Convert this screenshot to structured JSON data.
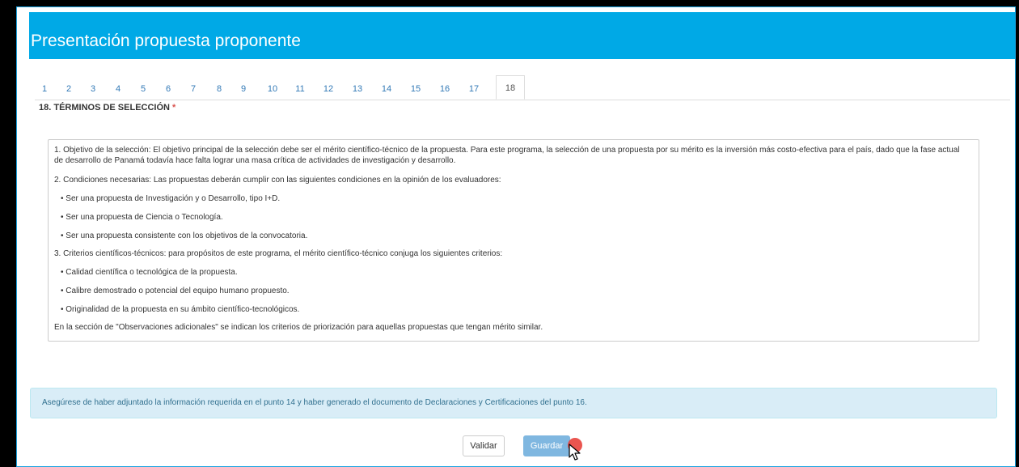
{
  "page": {
    "title": "Presentación propuesta proponente"
  },
  "tabs": [
    {
      "label": "1"
    },
    {
      "label": "2"
    },
    {
      "label": "3"
    },
    {
      "label": "4"
    },
    {
      "label": "5"
    },
    {
      "label": "6"
    },
    {
      "label": "7"
    },
    {
      "label": "8"
    },
    {
      "label": "9"
    },
    {
      "label": "10"
    },
    {
      "label": "11"
    },
    {
      "label": "12"
    },
    {
      "label": "13"
    },
    {
      "label": "14"
    },
    {
      "label": "15"
    },
    {
      "label": "16"
    },
    {
      "label": "17"
    },
    {
      "label": "18",
      "active": true
    }
  ],
  "section": {
    "title": "18. TÉRMINOS DE SELECCIÓN",
    "required_mark": "*"
  },
  "terms": {
    "paragraphs": [
      "1. Objetivo de la selección: El objetivo principal de la selección debe ser el mérito científico-técnico de la propuesta. Para este programa, la selección de una propuesta por su mérito es la inversión más costo-efectiva para el país, dado que la fase actual de desarrollo de Panamá todavía hace falta lograr una masa crítica de actividades de investigación y desarrollo.",
      "2. Condiciones necesarias: Las propuestas deberán cumplir con las siguientes condiciones en la opinión de los evaluadores:",
      "• Ser una propuesta de Investigación y o Desarrollo, tipo I+D.",
      "• Ser una propuesta de Ciencia o Tecnología.",
      "• Ser una propuesta consistente con los objetivos de la convocatoria.",
      "3. Criterios científicos-técnicos: para propósitos de este programa, el mérito científico-técnico conjuga los siguientes criterios:",
      "• Calidad científica o tecnológica de la propuesta.",
      "• Calibre demostrado o potencial del equipo humano propuesto.",
      "• Originalidad de la propuesta en su ámbito científico-tecnológicos.",
      "En la sección de \"Observaciones adicionales\" se indican los criterios de priorización para aquellas propuestas que tengan mérito similar."
    ]
  },
  "alert": {
    "text": "Asegúrese de haber adjuntado la información requerida en el punto 14 y haber generado el documento de Declaraciones y Certificaciones del punto 16."
  },
  "actions": {
    "validate_label": "Validar",
    "save_label": "Guardar"
  },
  "colors": {
    "header_bg": "#00a9e6",
    "tab_link": "#337ab7",
    "alert_bg": "#d9edf7",
    "alert_text": "#31708f",
    "save_button": "#7fb7e0",
    "click_indicator": "#e8433c"
  }
}
